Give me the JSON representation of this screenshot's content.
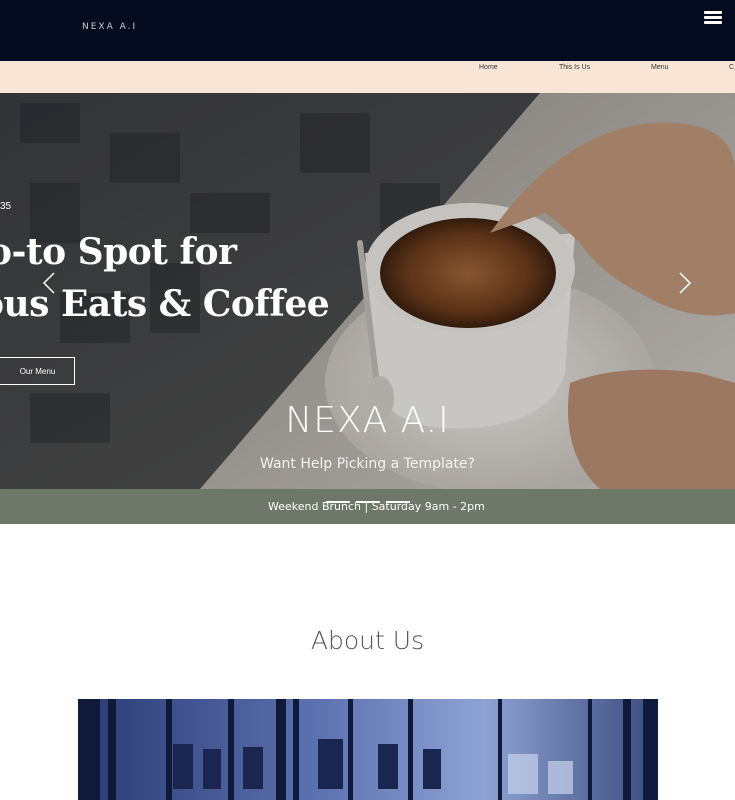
{
  "header": {
    "logo_text": "NEXA A.I"
  },
  "nav": {
    "items": [
      {
        "label": "Home"
      },
      {
        "label": "This Is Us"
      },
      {
        "label": "Menu"
      },
      {
        "label": "C"
      }
    ]
  },
  "hero": {
    "kicker": "35",
    "headline_line1": "o-to Spot for",
    "headline_line2": "ous Eats & Coffee",
    "menu_button": "Our Menu",
    "brand_title": "NEXA A.I",
    "brand_subtitle": "Want Help Picking a Template?"
  },
  "announcement": {
    "text": "Weekend Brunch  |  Saturday 9am - 2pm"
  },
  "about": {
    "title": "About Us"
  },
  "icons": {
    "menu": "hamburger-icon",
    "prev": "chevron-left-icon",
    "next": "chevron-right-icon"
  },
  "colors": {
    "topbar": "#050c1f",
    "navbar": "#f9e5d5",
    "announcement": "#6e7868",
    "about_title": "#555555"
  }
}
